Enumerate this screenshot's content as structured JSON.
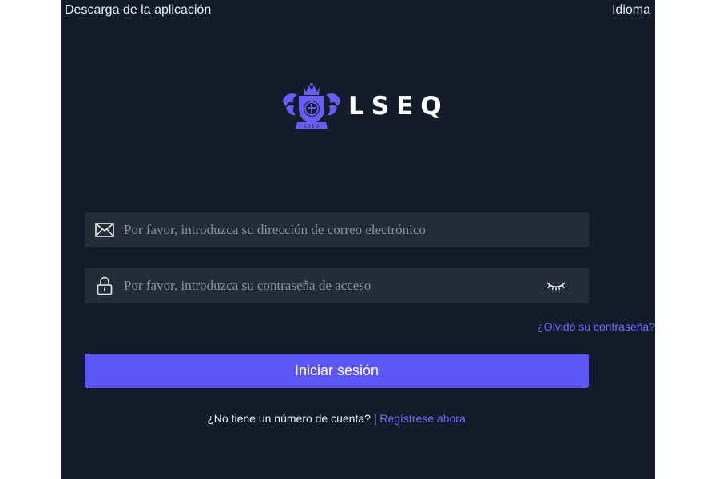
{
  "header": {
    "download_label": "Descarga de la aplicación",
    "language_label": "Idioma"
  },
  "logo": {
    "text": "LSEQ",
    "icon": "crest-logo-icon"
  },
  "login_form": {
    "email_placeholder": "Por favor, introduzca su dirección de correo electrónico",
    "email_icon": "envelope-icon",
    "password_placeholder": "Por favor, introduzca su contraseña de acceso",
    "password_icon": "lock-icon",
    "password_toggle_icon": "eye-closed-icon",
    "forgot_password_label": "¿Olvidó su contraseña?",
    "submit_label": "Iniciar sesión",
    "no_account_text": "¿No tiene un número de cuenta?",
    "separator": "|",
    "register_label": "Regístrese ahora"
  },
  "colors": {
    "background": "#141b2b",
    "field_background": "#252c38",
    "accent": "#5b56f5",
    "link": "#6e6bff"
  }
}
